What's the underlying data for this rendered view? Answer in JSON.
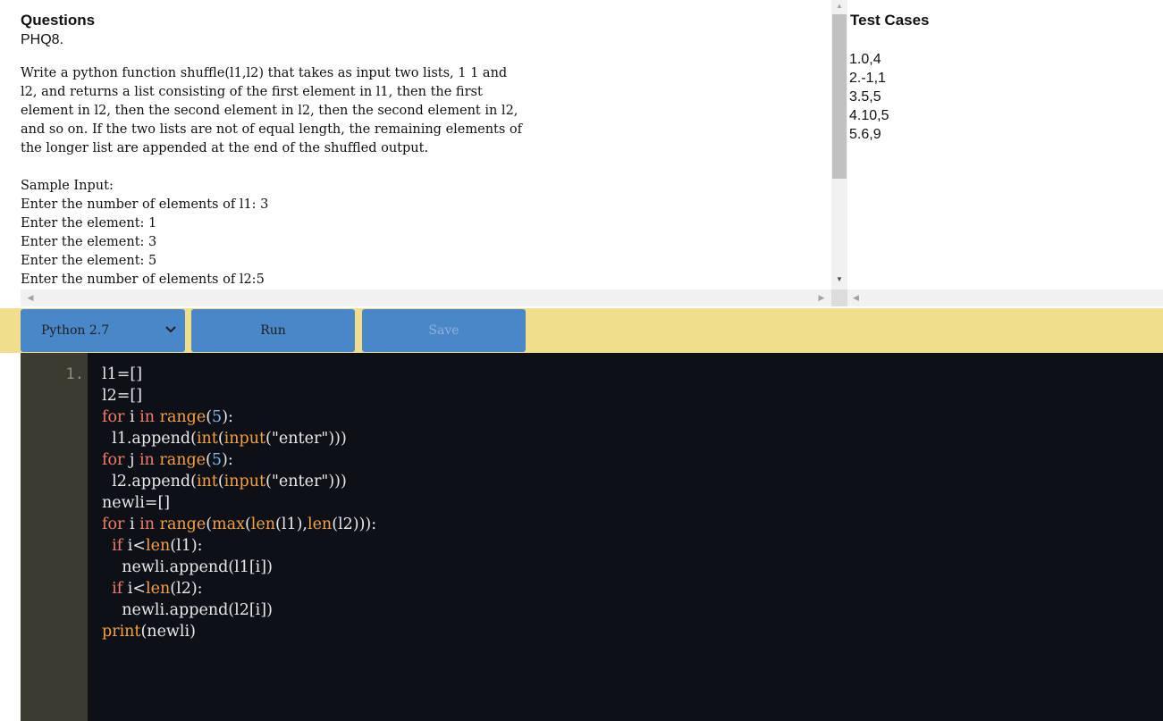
{
  "questions": {
    "title": "Questions",
    "id": "PHQ8.",
    "description_lines": [
      "Write a python function shuffle(l1,l2) that takes as input two lists, 1 1 and",
      "l2, and returns a list consisting of the first element in l1, then the first",
      "element in l2, then the second element in l2, then the second element in l2,",
      "and so on. If the two lists are not of equal length, the remaining elements of",
      "the longer list are appended at the end of the shuffled output."
    ],
    "sample_lines": [
      "Sample Input:",
      "Enter the number of elements of l1: 3",
      "Enter the element: 1",
      "Enter the element: 3",
      "Enter the element: 5",
      "Enter the number of elements of l2:5"
    ]
  },
  "test_cases": {
    "title": "Test Cases",
    "items": [
      "1.0,4",
      "2.-1,1",
      "3.5,5",
      "4.10,5",
      "5.6,9"
    ]
  },
  "toolbar": {
    "language": "Python 2.7",
    "run_label": "Run",
    "save_label": "Save"
  },
  "editor": {
    "line_number": "1.",
    "lines": [
      {
        "indent": "",
        "tokens": [
          {
            "t": "l1=[]",
            "c": "tx"
          }
        ]
      },
      {
        "indent": "",
        "tokens": [
          {
            "t": "l2=[]",
            "c": "tx"
          }
        ]
      },
      {
        "indent": "",
        "tokens": [
          {
            "t": "for",
            "c": "kw"
          },
          {
            "t": " i ",
            "c": "tx"
          },
          {
            "t": "in",
            "c": "kw"
          },
          {
            "t": " ",
            "c": "tx"
          },
          {
            "t": "range",
            "c": "fn"
          },
          {
            "t": "(",
            "c": "tx"
          },
          {
            "t": "5",
            "c": "nm"
          },
          {
            "t": "):",
            "c": "tx"
          }
        ]
      },
      {
        "indent": "  ",
        "tokens": [
          {
            "t": "l1.append(",
            "c": "tx"
          },
          {
            "t": "int",
            "c": "fn"
          },
          {
            "t": "(",
            "c": "tx"
          },
          {
            "t": "input",
            "c": "fn"
          },
          {
            "t": "(\"enter\")))",
            "c": "tx"
          }
        ]
      },
      {
        "indent": "",
        "tokens": [
          {
            "t": "for",
            "c": "kw"
          },
          {
            "t": " j ",
            "c": "tx"
          },
          {
            "t": "in",
            "c": "kw"
          },
          {
            "t": " ",
            "c": "tx"
          },
          {
            "t": "range",
            "c": "fn"
          },
          {
            "t": "(",
            "c": "tx"
          },
          {
            "t": "5",
            "c": "nm"
          },
          {
            "t": "):",
            "c": "tx"
          }
        ]
      },
      {
        "indent": "  ",
        "tokens": [
          {
            "t": "l2.append(",
            "c": "tx"
          },
          {
            "t": "int",
            "c": "fn"
          },
          {
            "t": "(",
            "c": "tx"
          },
          {
            "t": "input",
            "c": "fn"
          },
          {
            "t": "(\"enter\")))",
            "c": "tx"
          }
        ]
      },
      {
        "indent": "",
        "tokens": [
          {
            "t": "newli=[]",
            "c": "tx"
          }
        ]
      },
      {
        "indent": "",
        "tokens": [
          {
            "t": "for",
            "c": "kw"
          },
          {
            "t": " i ",
            "c": "tx"
          },
          {
            "t": "in",
            "c": "kw"
          },
          {
            "t": " ",
            "c": "tx"
          },
          {
            "t": "range",
            "c": "fn"
          },
          {
            "t": "(",
            "c": "tx"
          },
          {
            "t": "max",
            "c": "fn"
          },
          {
            "t": "(",
            "c": "tx"
          },
          {
            "t": "len",
            "c": "fn"
          },
          {
            "t": "(l1),",
            "c": "tx"
          },
          {
            "t": "len",
            "c": "fn"
          },
          {
            "t": "(l2))):",
            "c": "tx"
          }
        ]
      },
      {
        "indent": "  ",
        "tokens": [
          {
            "t": "if",
            "c": "kw"
          },
          {
            "t": " i<",
            "c": "tx"
          },
          {
            "t": "len",
            "c": "fn"
          },
          {
            "t": "(l1):",
            "c": "tx"
          }
        ]
      },
      {
        "indent": "    ",
        "tokens": [
          {
            "t": "newli.append(l1[i])",
            "c": "tx"
          }
        ]
      },
      {
        "indent": "  ",
        "tokens": [
          {
            "t": "if",
            "c": "kw"
          },
          {
            "t": " i<",
            "c": "tx"
          },
          {
            "t": "len",
            "c": "fn"
          },
          {
            "t": "(l2):",
            "c": "tx"
          }
        ]
      },
      {
        "indent": "    ",
        "tokens": [
          {
            "t": "newli.append(l2[i])",
            "c": "tx"
          }
        ]
      },
      {
        "indent": "",
        "tokens": [
          {
            "t": "print",
            "c": "fn"
          },
          {
            "t": "(newli)",
            "c": "tx"
          }
        ]
      }
    ]
  },
  "colors": {
    "toolbar_bg": "#f0de8c",
    "button_bg": "#4a87c8",
    "editor_bg": "#0d1117",
    "gutter_bg": "#3b3b32",
    "keyword": "#f47b6b",
    "builtin": "#f5a043",
    "number": "#7fb8f0"
  }
}
